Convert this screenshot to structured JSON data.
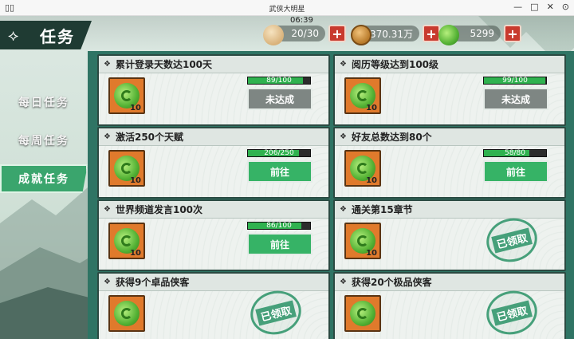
{
  "window": {
    "app_icon": "▯▯",
    "title": "武侠大明星",
    "controls": [
      "—",
      "□",
      "✕",
      "⊙"
    ]
  },
  "header": {
    "title": "任务",
    "timer": "06:39",
    "resources": [
      {
        "icon": "steamed-bun-icon",
        "value": "20/30"
      },
      {
        "icon": "copper-coin-icon",
        "value": "370.31万"
      },
      {
        "icon": "jade-gem-icon",
        "value": "5299"
      }
    ],
    "plus_label": "+"
  },
  "sidebar": {
    "items": [
      {
        "label": "每日任务",
        "active": false
      },
      {
        "label": "每周任务",
        "active": false
      },
      {
        "label": "成就任务",
        "active": true
      }
    ]
  },
  "tasks": [
    {
      "title": "累计登录天数达100天",
      "reward_count": "10",
      "progress": {
        "text": "89/100",
        "fraction": 0.89
      },
      "action": "未达成",
      "state": "not_reached"
    },
    {
      "title": "阅历等级达到100级",
      "reward_count": "10",
      "progress": {
        "text": "99/100",
        "fraction": 0.99
      },
      "action": "未达成",
      "state": "not_reached"
    },
    {
      "title": "激活250个天赋",
      "reward_count": "10",
      "progress": {
        "text": "206/250",
        "fraction": 0.824
      },
      "action": "前往",
      "state": "goto"
    },
    {
      "title": "好友总数达到80个",
      "reward_count": "10",
      "progress": {
        "text": "58/80",
        "fraction": 0.725
      },
      "action": "前往",
      "state": "goto"
    },
    {
      "title": "世界频道发言100次",
      "reward_count": "10",
      "progress": {
        "text": "86/100",
        "fraction": 0.86
      },
      "action": "前往",
      "state": "goto"
    },
    {
      "title": "通关第15章节",
      "reward_count": "10",
      "stamp": "已领取",
      "state": "claimed"
    },
    {
      "title": "获得9个卓品侠客",
      "reward_count": "",
      "stamp": "已领取",
      "state": "claimed"
    },
    {
      "title": "获得20个极品侠客",
      "reward_count": "",
      "stamp": "已领取",
      "state": "claimed"
    }
  ],
  "colors": {
    "accent_green": "#36b366",
    "disabled_gray": "#7e8683",
    "plus_red": "#c83a2e",
    "panel_teal": "#2f7464"
  }
}
